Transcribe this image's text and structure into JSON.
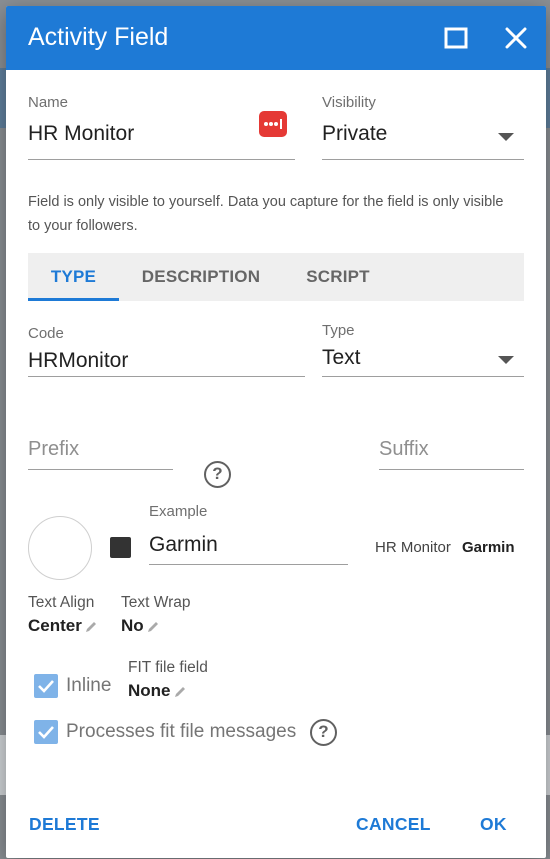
{
  "dialog": {
    "title": "Activity Field",
    "maximize_icon": "maximize-icon",
    "close_icon": "close-icon"
  },
  "name": {
    "label": "Name",
    "value": "HR Monitor",
    "icon": "password-dots-icon"
  },
  "visibility": {
    "label": "Visibility",
    "value": "Private"
  },
  "info_text": "Field is only visible to yourself. Data you capture for the field is only visible to your followers.",
  "tabs": [
    {
      "label": "TYPE"
    },
    {
      "label": "DESCRIPTION"
    },
    {
      "label": "SCRIPT"
    }
  ],
  "active_tab": "TYPE",
  "code": {
    "label": "Code",
    "value": "HRMonitor"
  },
  "type": {
    "label": "Type",
    "value": "Text"
  },
  "prefix": {
    "placeholder": "Prefix"
  },
  "suffix": {
    "placeholder": "Suffix"
  },
  "example": {
    "label": "Example",
    "value": "Garmin"
  },
  "preview": {
    "label": "HR Monitor",
    "value": "Garmin"
  },
  "text_align": {
    "label": "Text Align",
    "value": "Center"
  },
  "text_wrap": {
    "label": "Text Wrap",
    "value": "No"
  },
  "fit_file_field": {
    "label": "FIT file field",
    "value": "None"
  },
  "inline": {
    "label": "Inline",
    "checked": true
  },
  "processes_fit": {
    "label": "Processes fit file messages",
    "checked": true
  },
  "buttons": {
    "delete": "DELETE",
    "cancel": "CANCEL",
    "ok": "OK"
  },
  "colors": {
    "accent": "#1e7ad6",
    "checkbox": "#7fb3e8",
    "icon_red": "#e53935",
    "swatch": "#333333"
  }
}
